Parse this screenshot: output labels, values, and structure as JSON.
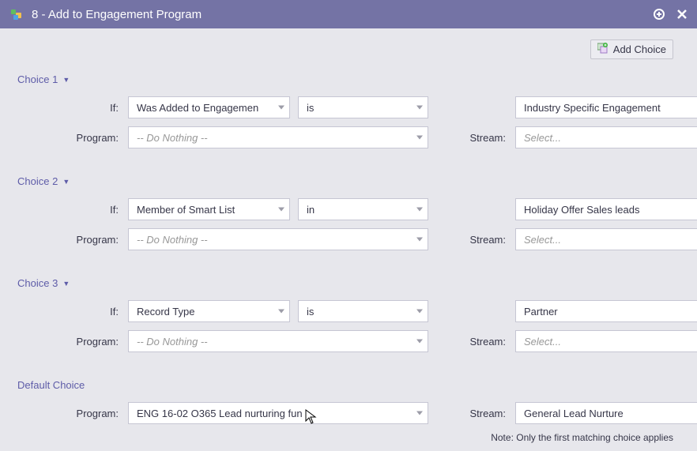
{
  "titlebar": {
    "title": "8 - Add to Engagement Program"
  },
  "add_choice_label": "Add Choice",
  "labels": {
    "if": "If:",
    "program": "Program:",
    "stream": "Stream:"
  },
  "placeholders": {
    "do_nothing": "-- Do Nothing --",
    "select": "Select..."
  },
  "choices": [
    {
      "title": "Choice 1",
      "if_field": "Was Added to Engagemen",
      "if_op": "is",
      "if_value": "Industry Specific Engagement",
      "has_plus": true
    },
    {
      "title": "Choice 2",
      "if_field": "Member of Smart List",
      "if_op": "in",
      "if_value": "Holiday Offer Sales leads",
      "has_plus": false
    },
    {
      "title": "Choice 3",
      "if_field": "Record Type",
      "if_op": "is",
      "if_value": "Partner",
      "has_plus": true
    }
  ],
  "default_choice": {
    "title": "Default Choice",
    "program": "ENG 16-02 O365 Lead nurturing fun",
    "stream": "General Lead Nurture"
  },
  "note": "Note: Only the first matching choice applies"
}
